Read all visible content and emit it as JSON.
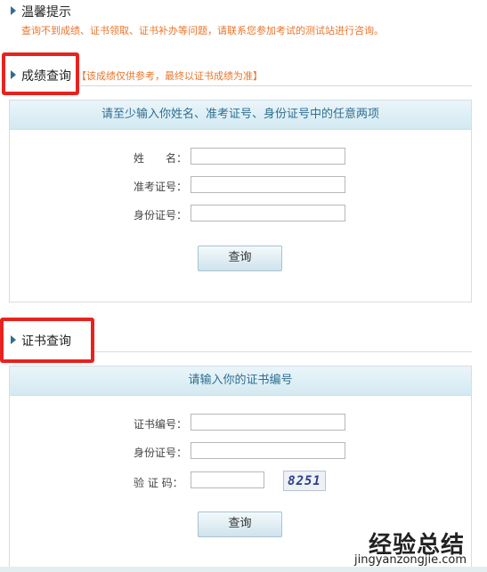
{
  "tips": {
    "title": "温馨提示",
    "text": "查询不到成绩、证书领取、证书补办等问题，请联系您参加考试的测试站进行咨询。"
  },
  "score_section": {
    "title": "成绩查询",
    "disclaimer": "【该成绩仅供参考，最终以证书成绩为准】",
    "panel_header": "请至少输入你姓名、准考证号、身份证号中的任意两项",
    "fields": {
      "name_label": "姓　　名：",
      "name_value": "",
      "exam_no_label": "准考证号：",
      "exam_no_value": "",
      "id_label": "身份证号：",
      "id_value": ""
    },
    "query_button": "查询"
  },
  "cert_section": {
    "title": "证书查询",
    "panel_header": "请输入你的证书编号",
    "fields": {
      "cert_no_label": "证书编号：",
      "cert_no_value": "",
      "id_label": "身份证号：",
      "id_value": "",
      "captcha_label": "验 证 码：",
      "captcha_value": "",
      "captcha_image_text": "8251"
    },
    "query_button": "查询"
  },
  "watermark": {
    "main": "经验总结",
    "sub": "jingyanzongjie.com"
  },
  "colors": {
    "highlight_box": "#e8221e",
    "hint_orange": "#e8762c",
    "panel_header_text": "#2f6f8f"
  }
}
